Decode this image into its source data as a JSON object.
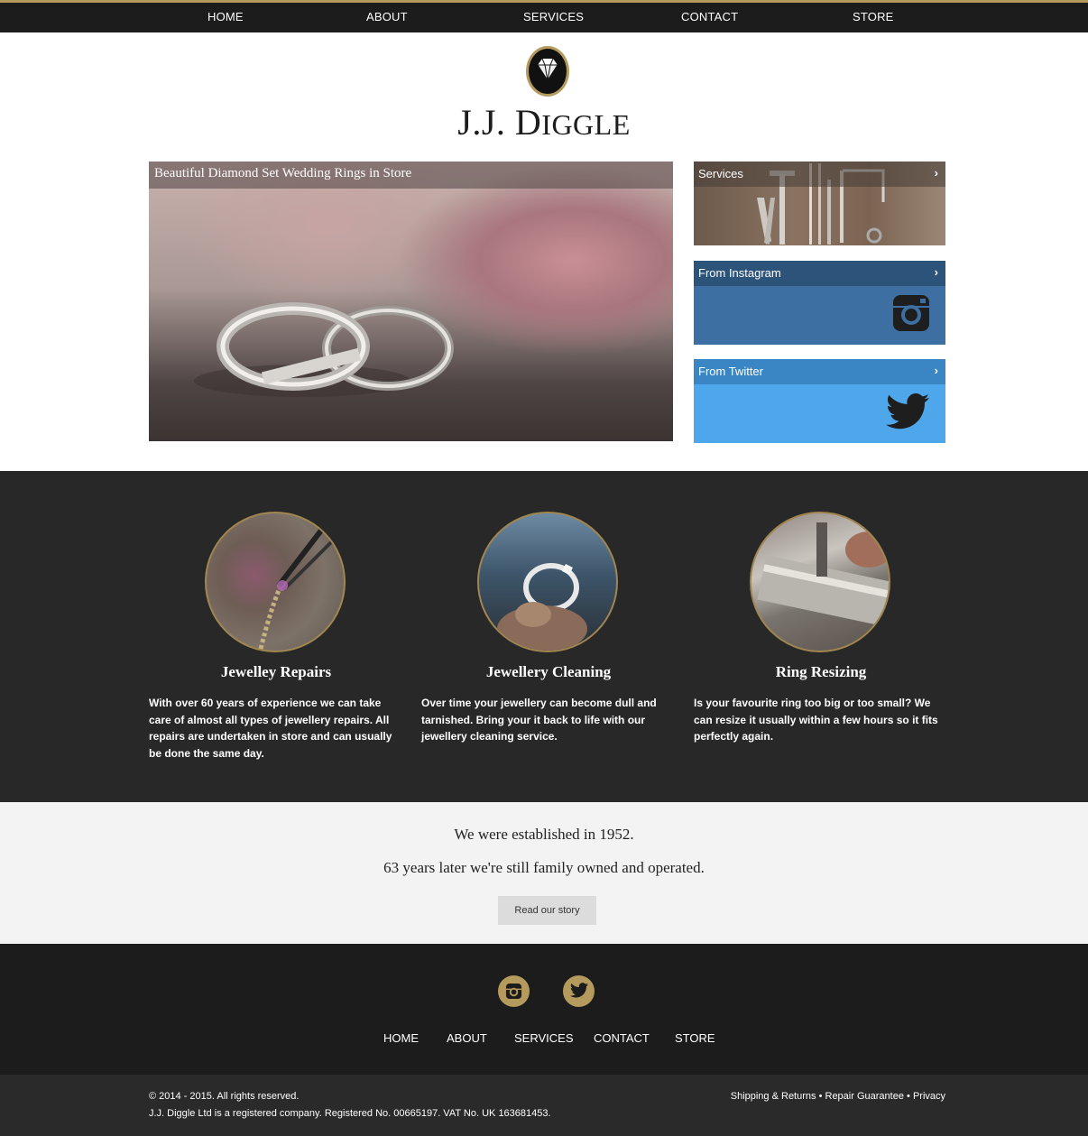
{
  "nav": {
    "items": [
      "HOME",
      "ABOUT",
      "SERVICES",
      "CONTACT",
      "STORE"
    ]
  },
  "brand": {
    "name_first": "J.J. D",
    "name_rest": "IGGLE",
    "logo_icon": "diamond-icon"
  },
  "hero": {
    "caption": "Beautiful Diamond Set Wedding Rings in Store"
  },
  "tiles": {
    "services": {
      "label": "Services",
      "icon": "chevron-right-icon"
    },
    "instagram": {
      "label": "From Instagram",
      "icon": "instagram-icon"
    },
    "twitter": {
      "label": "From Twitter",
      "icon": "twitter-icon"
    }
  },
  "services": [
    {
      "title": "Jewelley Repairs",
      "text": "With over 60 years of experience we can take care of almost all types of jewellery repairs. All repairs are undertaken in store and can usually be done the same day."
    },
    {
      "title": "Jewellery Cleaning",
      "text": "Over time your jewellery can become dull and tarnished. Bring your it back to life with our jewellery cleaning service."
    },
    {
      "title": "Ring Resizing",
      "text": "Is your favourite ring too big or too small? We can resize it usually within a few hours so it fits perfectly again."
    }
  ],
  "established": {
    "line1": "We were established in 1952.",
    "line2": "63 years later we're still family owned and operated.",
    "button": "Read our story"
  },
  "footer": {
    "nav": [
      "HOME",
      "ABOUT",
      "SERVICES",
      "CONTACT",
      "STORE"
    ],
    "copyright": "© 2014 - 2015. All rights reserved.",
    "company": "J.J. Diggle Ltd is a registered company. Registered No. 00665197. VAT No. UK 163681453.",
    "links": [
      "Shipping & Returns",
      "Repair Guarantee",
      "Privacy"
    ],
    "separator": "•"
  },
  "colors": {
    "accent_gold": "#b59a5e",
    "dark_bg": "#282828",
    "instagram_blue": "#3d6fa2",
    "twitter_blue": "#4da7ea"
  }
}
